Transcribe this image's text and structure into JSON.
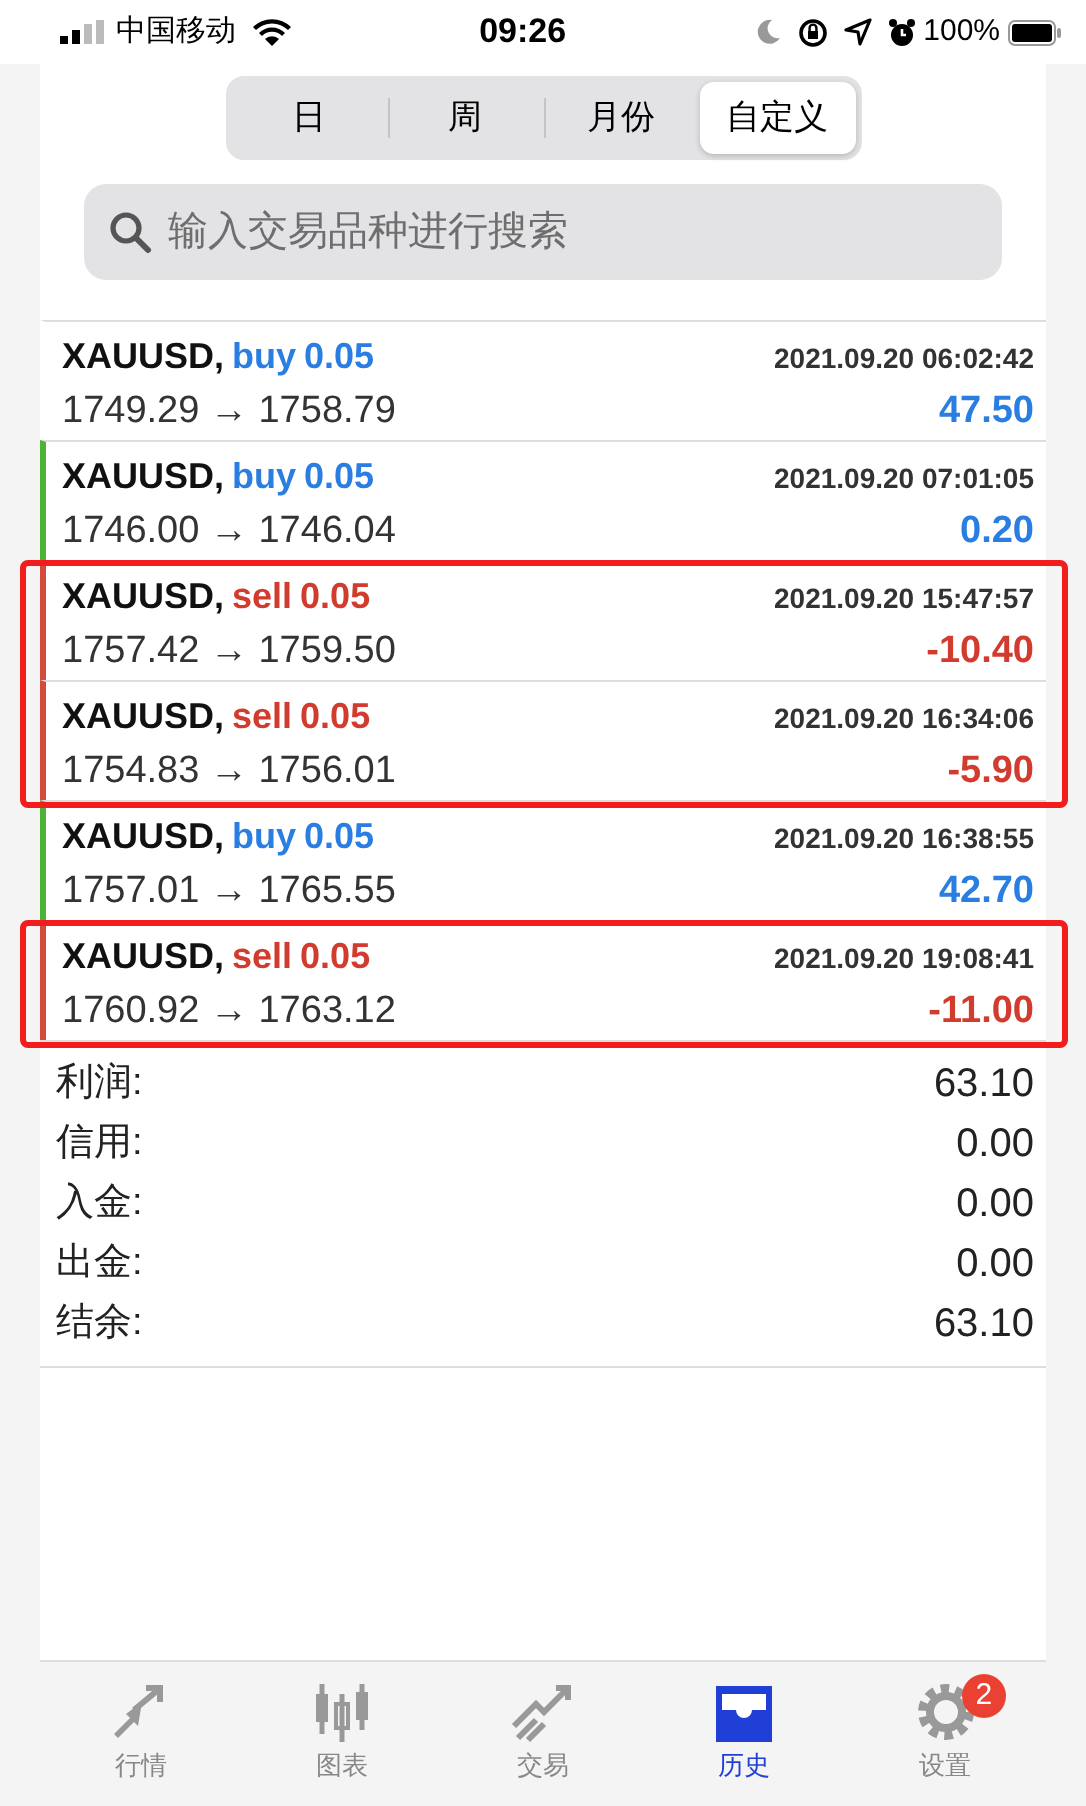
{
  "status_bar": {
    "carrier": "中国移动",
    "time": "09:26",
    "battery": "100%"
  },
  "period_tabs": [
    {
      "label": "日",
      "selected": false
    },
    {
      "label": "周",
      "selected": false
    },
    {
      "label": "月份",
      "selected": false
    },
    {
      "label": "自定义",
      "selected": true
    }
  ],
  "search": {
    "placeholder": "输入交易品种进行搜索"
  },
  "trades": [
    {
      "symbol": "XAUUSD,",
      "side": "buy",
      "volume": "0.05",
      "time": "2021.09.20 06:02:42",
      "prices": "1749.29 → 1758.79",
      "profit": "47.50",
      "highlighted": false
    },
    {
      "symbol": "XAUUSD,",
      "side": "buy",
      "volume": "0.05",
      "time": "2021.09.20 07:01:05",
      "prices": "1746.00 → 1746.04",
      "profit": "0.20",
      "color": "#4cb335",
      "highlighted": false
    },
    {
      "symbol": "XAUUSD,",
      "side": "sell",
      "volume": "0.05",
      "time": "2021.09.20 15:47:57",
      "prices": "1757.42 → 1759.50",
      "profit": "-10.40",
      "color": "#d24b3c",
      "highlighted": true
    },
    {
      "symbol": "XAUUSD,",
      "side": "sell",
      "volume": "0.05",
      "time": "2021.09.20 16:34:06",
      "prices": "1754.83 → 1756.01",
      "profit": "-5.90",
      "color": "#d24b3c",
      "highlighted": true
    },
    {
      "symbol": "XAUUSD,",
      "side": "buy",
      "volume": "0.05",
      "time": "2021.09.20 16:38:55",
      "prices": "1757.01 → 1765.55",
      "profit": "42.70",
      "color": "#4cb335",
      "highlighted": false
    },
    {
      "symbol": "XAUUSD,",
      "side": "sell",
      "volume": "0.05",
      "time": "2021.09.20 19:08:41",
      "prices": "1760.92 → 1763.12",
      "profit": "-11.00",
      "color": "#d24b3c",
      "highlighted": true
    }
  ],
  "summary": [
    {
      "label": "利润:",
      "value": "63.10"
    },
    {
      "label": "信用:",
      "value": "0.00"
    },
    {
      "label": "入金:",
      "value": "0.00"
    },
    {
      "label": "出金:",
      "value": "0.00"
    },
    {
      "label": "结余:",
      "value": "63.10"
    }
  ],
  "bottom_tabs": [
    {
      "kind": "quotes",
      "label": "行情",
      "selected": false
    },
    {
      "kind": "chart",
      "label": "图表",
      "selected": false
    },
    {
      "kind": "trade",
      "label": "交易",
      "selected": false
    },
    {
      "kind": "history",
      "label": "历史",
      "selected": true
    },
    {
      "kind": "settings",
      "label": "设置",
      "selected": false,
      "badge": "2"
    }
  ]
}
